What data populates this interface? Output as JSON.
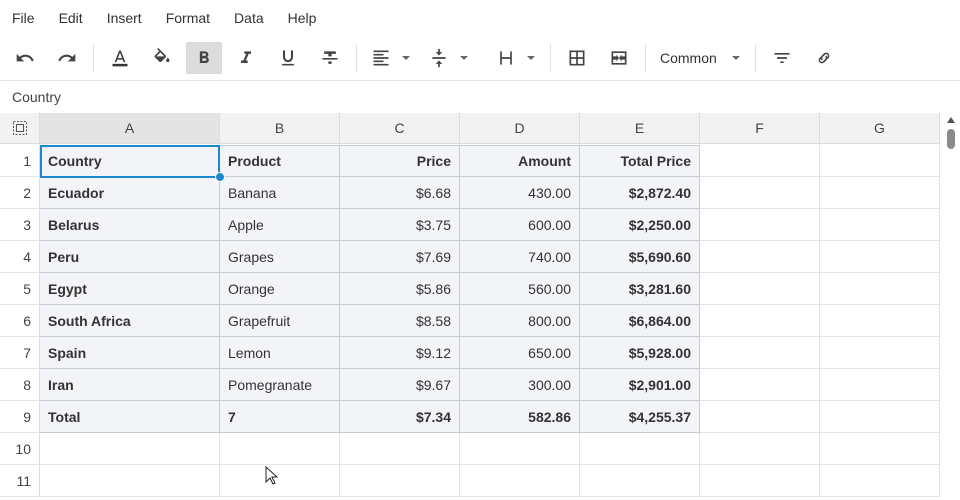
{
  "menu": [
    "File",
    "Edit",
    "Insert",
    "Format",
    "Data",
    "Help"
  ],
  "toolbar": {
    "format_label": "Common",
    "icons": [
      "undo-icon",
      "redo-icon",
      "text-color-icon",
      "fill-color-icon",
      "bold-icon",
      "italic-icon",
      "underline-icon",
      "strikethrough-icon",
      "align-icon",
      "vertical-align-icon",
      "text-wrap-icon",
      "borders-icon",
      "merge-cells-icon",
      "filter-icon",
      "link-icon"
    ],
    "text_color": "#333333",
    "active_color": "#dcdcdc"
  },
  "formula_bar": {
    "value": "Country"
  },
  "grid": {
    "columns": [
      "A",
      "B",
      "C",
      "D",
      "E",
      "F",
      "G"
    ],
    "selected_column": "A",
    "rows": [
      "1",
      "2",
      "3",
      "4",
      "5",
      "6",
      "7",
      "8",
      "9",
      "10",
      "11"
    ],
    "data": [
      [
        "Country",
        "Product",
        "Price",
        "Amount",
        "Total Price"
      ],
      [
        "Ecuador",
        "Banana",
        "$6.68",
        "430.00",
        "$2,872.40"
      ],
      [
        "Belarus",
        "Apple",
        "$3.75",
        "600.00",
        "$2,250.00"
      ],
      [
        "Peru",
        "Grapes",
        "$7.69",
        "740.00",
        "$5,690.60"
      ],
      [
        "Egypt",
        "Orange",
        "$5.86",
        "560.00",
        "$3,281.60"
      ],
      [
        "South Africa",
        "Grapefruit",
        "$8.58",
        "800.00",
        "$6,864.00"
      ],
      [
        "Spain",
        "Lemon",
        "$9.12",
        "650.00",
        "$5,928.00"
      ],
      [
        "Iran",
        "Pomegranate",
        "$9.67",
        "300.00",
        "$2,901.00"
      ],
      [
        "Total",
        "7",
        "$7.34",
        "582.86",
        "$4,255.37"
      ]
    ],
    "selection_color": "#1e88cf"
  }
}
